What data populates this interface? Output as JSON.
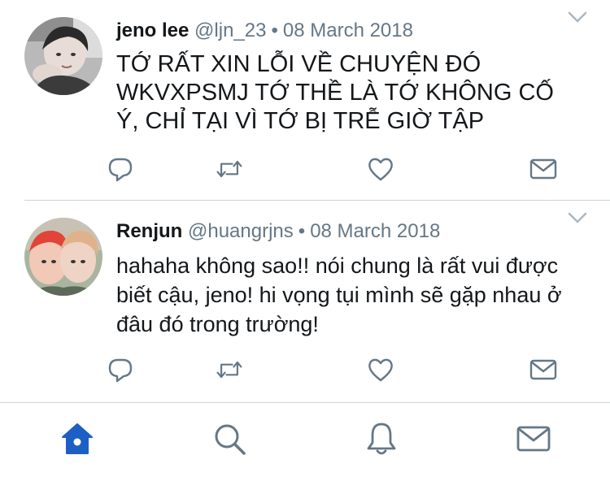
{
  "colors": {
    "text": "#14171a",
    "muted": "#657786",
    "icon": "#657786",
    "active": "#1d5fc4",
    "divider": "#ccd6dd"
  },
  "tweets": [
    {
      "name": "jeno lee",
      "handle": "@ljn_23",
      "separator": "•",
      "date": "08 March 2018",
      "text": "TỚ RẤT XIN LỖI VỀ CHUYỆN ĐÓ WKVXPSMJ TỚ THỀ LÀ TỚ KHÔNG CỐ Ý, CHỈ TẠI VÌ TỚ BỊ TRỄ GIỜ TẬP"
    },
    {
      "name": "Renjun",
      "handle": "@huangrjns",
      "separator": "•",
      "date": "08 March 2018",
      "text": "hahaha không sao!! nói chung là rất vui được biết cậu, jeno! hi vọng tụi mình sẽ gặp nhau ở đâu đó trong trường!"
    }
  ],
  "tweet_actions": [
    "reply-icon",
    "retweet-icon",
    "like-icon",
    "direct-message-icon"
  ],
  "tab_bar": {
    "active_tab": "home",
    "tabs": [
      "home-icon",
      "search-icon",
      "notifications-icon",
      "messages-icon"
    ]
  }
}
